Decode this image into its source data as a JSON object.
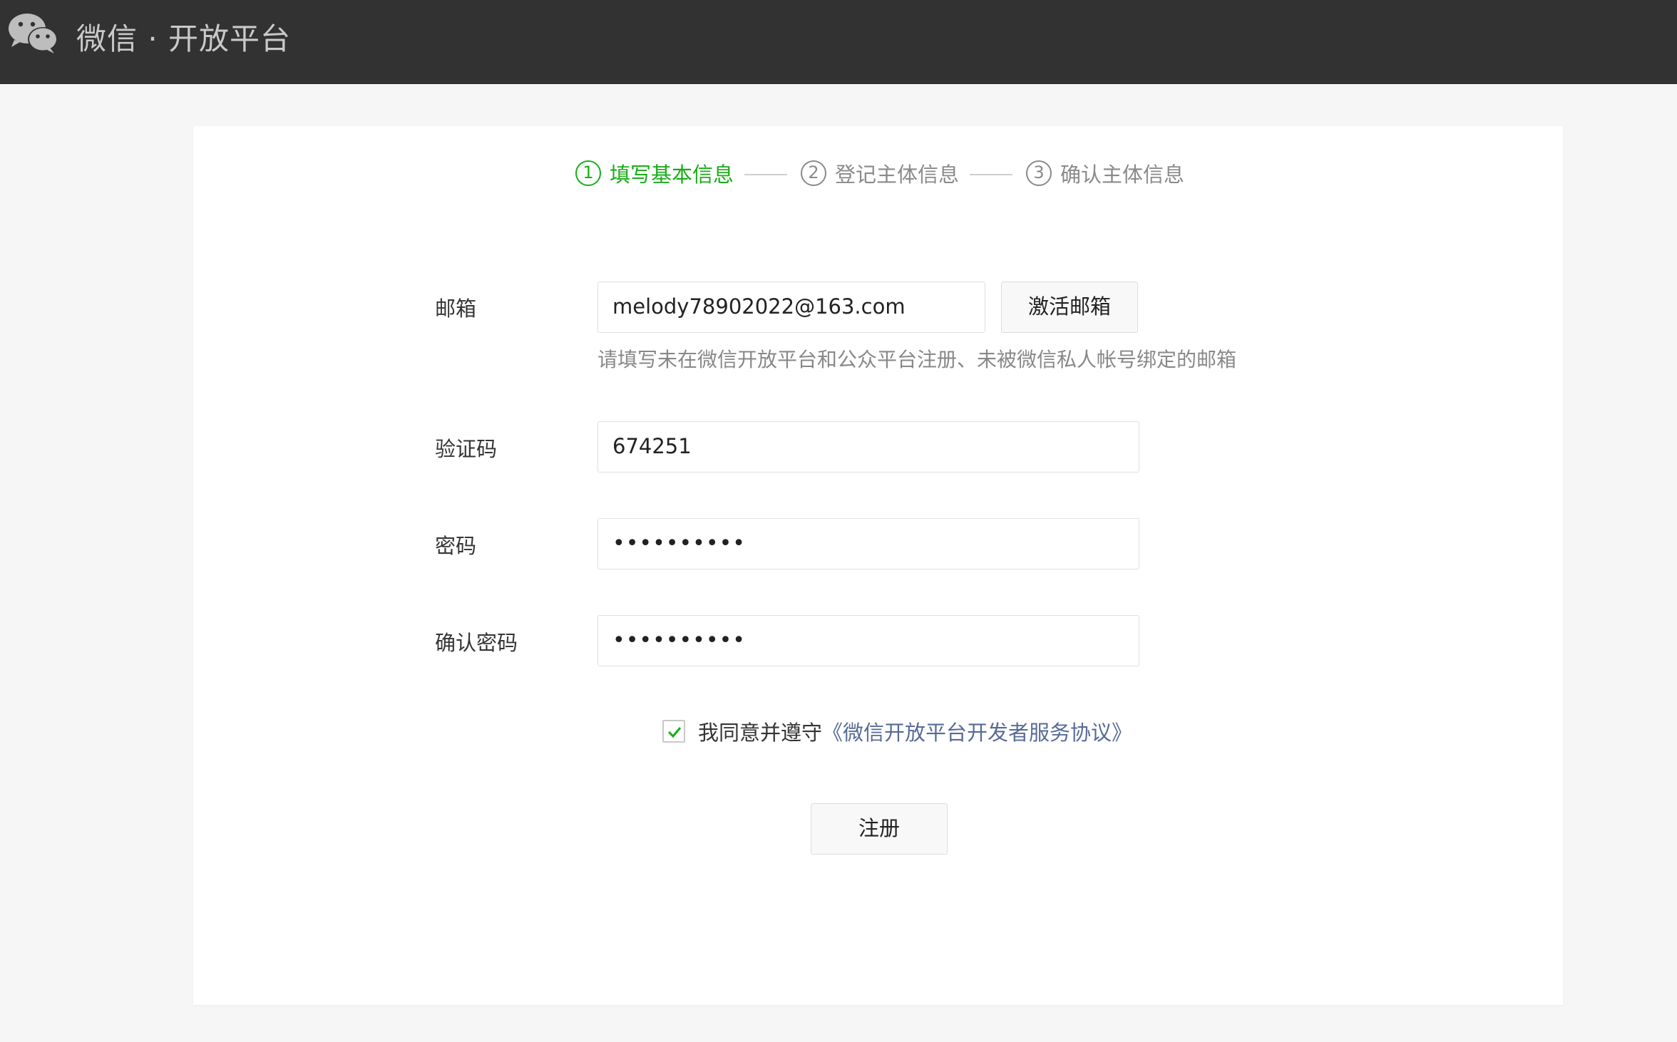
{
  "header": {
    "title": "微信 · 开放平台"
  },
  "steps": [
    {
      "number": "1",
      "label": "填写基本信息",
      "state": "active"
    },
    {
      "number": "2",
      "label": "登记主体信息",
      "state": "inactive"
    },
    {
      "number": "3",
      "label": "确认主体信息",
      "state": "inactive"
    }
  ],
  "form": {
    "email": {
      "label": "邮箱",
      "value": "melody78902022@163.com",
      "activate_button": "激活邮箱",
      "hint": "请填写未在微信开放平台和公众平台注册、未被微信私人帐号绑定的邮箱"
    },
    "code": {
      "label": "验证码",
      "value": "674251"
    },
    "password": {
      "label": "密码",
      "masked_value": "••••••••••"
    },
    "confirm_password": {
      "label": "确认密码",
      "masked_value": "••••••••••"
    },
    "agreement": {
      "checked": true,
      "text": "我同意并遵守",
      "link": "《微信开放平台开发者服务协议》"
    },
    "submit_label": "注册"
  },
  "colors": {
    "header_bg": "#323232",
    "active_green": "#1aad19",
    "link_blue": "#576b95",
    "page_bg": "#f6f6f6"
  },
  "icons": {
    "logo": "wechat-logo-icon",
    "checkmark": "checkmark-icon"
  }
}
